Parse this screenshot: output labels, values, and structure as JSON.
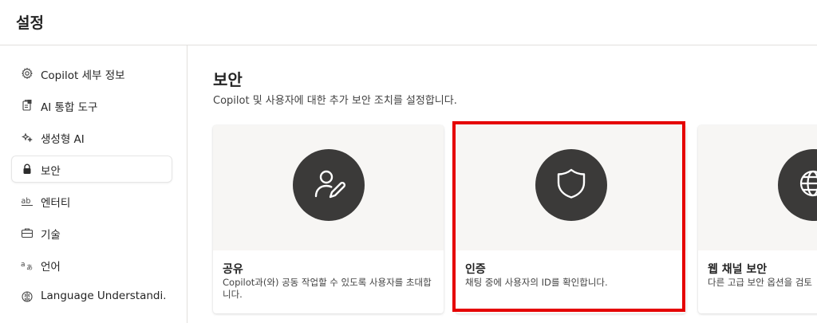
{
  "header": {
    "title": "설정"
  },
  "sidebar": {
    "items": [
      {
        "label": "Copilot 세부 정보",
        "icon": "gear-icon"
      },
      {
        "label": "AI 통합 도구",
        "icon": "integration-tools-icon"
      },
      {
        "label": "생성형 AI",
        "icon": "sparkle-icon"
      },
      {
        "label": "보안",
        "icon": "lock-icon",
        "active": true
      },
      {
        "label": "엔터티",
        "icon": "entity-ab-icon"
      },
      {
        "label": "기술",
        "icon": "briefcase-icon"
      },
      {
        "label": "언어",
        "icon": "language-icon"
      },
      {
        "label": "Language Understandi...",
        "icon": "brain-icon"
      }
    ]
  },
  "main": {
    "title": "보안",
    "description": "Copilot 및 사용자에 대한 추가 보안 조치를 설정합니다.",
    "cards": [
      {
        "title": "공유",
        "description": "Copilot과(와) 공동 작업할 수 있도록 사용자를 초대합니다.",
        "icon": "person-edit-icon"
      },
      {
        "title": "인증",
        "description": "채팅 중에 사용자의 ID를 확인합니다.",
        "icon": "shield-icon"
      },
      {
        "title": "웹 채널 보안",
        "description": "다른 고급 보안 옵션을 검토",
        "icon": "globe-shield-icon"
      }
    ]
  },
  "colors": {
    "highlight": "#e50000",
    "icon_circle": "#3b3a39",
    "hero_background": "#f7f6f4"
  }
}
